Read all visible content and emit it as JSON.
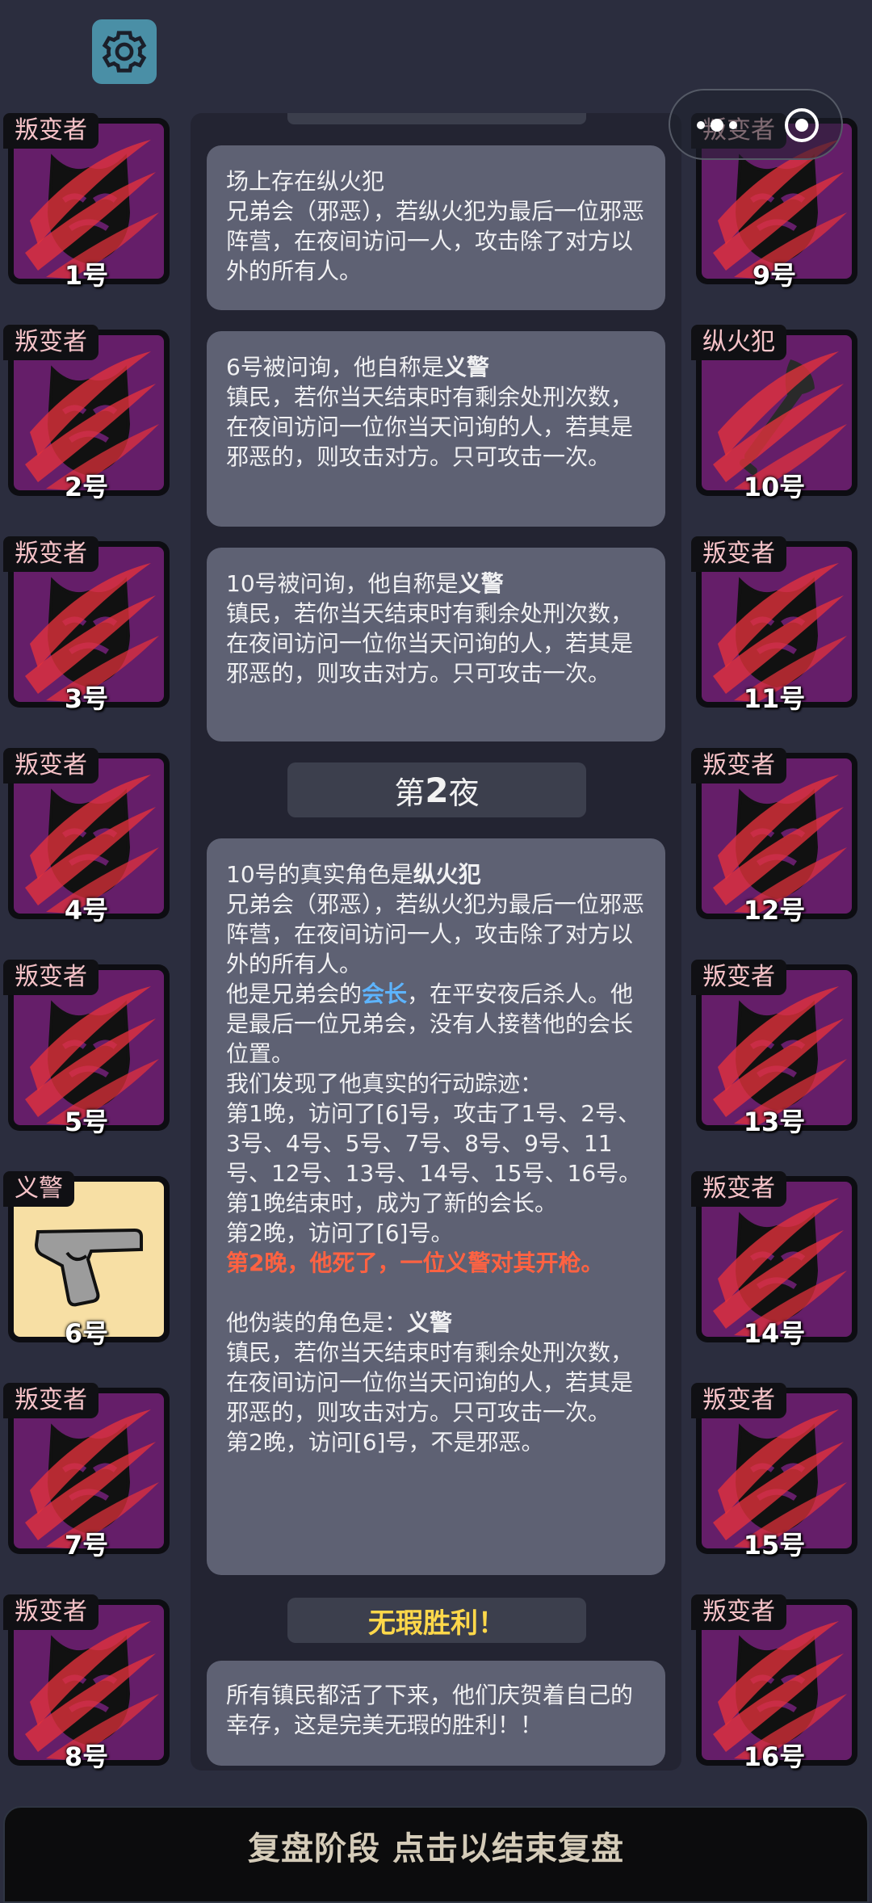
{
  "settings": {
    "icon": "gear-icon"
  },
  "capsule": {
    "menu_icon": "more-dots-icon",
    "close_icon": "target-icon"
  },
  "left_players": [
    {
      "role": "叛变者",
      "number": "1号",
      "icon": "mask-icon"
    },
    {
      "role": "叛变者",
      "number": "2号",
      "icon": "mask-icon"
    },
    {
      "role": "叛变者",
      "number": "3号",
      "icon": "mask-icon"
    },
    {
      "role": "叛变者",
      "number": "4号",
      "icon": "mask-icon"
    },
    {
      "role": "叛变者",
      "number": "5号",
      "icon": "mask-icon"
    },
    {
      "role": "义警",
      "number": "6号",
      "icon": "pistol-icon"
    },
    {
      "role": "叛变者",
      "number": "7号",
      "icon": "mask-icon"
    },
    {
      "role": "叛变者",
      "number": "8号",
      "icon": "mask-icon"
    }
  ],
  "right_players": [
    {
      "role": "叛变者",
      "number": "9号",
      "icon": "mask-icon"
    },
    {
      "role": "纵火犯",
      "number": "10号",
      "icon": "torch-icon"
    },
    {
      "role": "叛变者",
      "number": "11号",
      "icon": "mask-icon"
    },
    {
      "role": "叛变者",
      "number": "12号",
      "icon": "mask-icon"
    },
    {
      "role": "叛变者",
      "number": "13号",
      "icon": "mask-icon"
    },
    {
      "role": "叛变者",
      "number": "14号",
      "icon": "mask-icon"
    },
    {
      "role": "叛变者",
      "number": "15号",
      "icon": "mask-icon"
    },
    {
      "role": "叛变者",
      "number": "16号",
      "icon": "mask-icon"
    }
  ],
  "messages": {
    "m1": {
      "l1": "场上存在纵火犯",
      "l2": "兄弟会（邪恶），若纵火犯为最后一位邪恶阵营，在夜间访问一人，攻击除了对方以外的所有人。"
    },
    "m2": {
      "pre": "6号被问询，他自称是",
      "role": "义警",
      "desc": "镇民，若你当天结束时有剩余处刑次数，在夜间访问一位你当天问询的人，若其是邪恶的，则攻击对方。只可攻击一次。"
    },
    "m3": {
      "pre": "10号被问询，他自称是",
      "role": "义警",
      "desc": "镇民，若你当天结束时有剩余处刑次数，在夜间访问一位你当天问询的人，若其是邪恶的，则攻击对方。只可攻击一次。"
    },
    "night": {
      "pre": "第",
      "num": "2",
      "post": "夜"
    },
    "m4": {
      "pre": "10号的真实角色是",
      "role": "纵火犯",
      "desc": "兄弟会（邪恶），若纵火犯为最后一位邪恶阵营，在夜间访问一人，攻击除了对方以外的所有人。",
      "leader_pre": "他是兄弟会的",
      "leader": "会长",
      "leader_post": "，在平安夜后杀人。他是最后一位兄弟会，没有人接替他的会长位置。",
      "trace": "我们发现了他真实的行动踪迹：",
      "n1": "第1晚，访问了[6]号，攻击了1号、2号、3号、4号、5号、7号、8号、9号、11号、12号、13号、14号、15号、16号。",
      "n1end": "第1晚结束时，成为了新的会长。",
      "n2": "第2晚，访问了[6]号。",
      "death": "第2晚，他死了，一位义警对其开枪。",
      "disguise_pre": "他伪装的角色是：",
      "disguise": "义警",
      "disguise_desc": "镇民，若你当天结束时有剩余处刑次数，在夜间访问一位你当天问询的人，若其是邪恶的，则攻击对方。只可攻击一次。",
      "n2b": "第2晚，访问[6]号，不是邪恶。"
    },
    "victory": "无瑕胜利！",
    "m5": "所有镇民都活了下来，他们庆贺着自己的幸存，这是完美无瑕的胜利！！"
  },
  "bottom_bar": "复盘阶段 点击以结束复盘"
}
